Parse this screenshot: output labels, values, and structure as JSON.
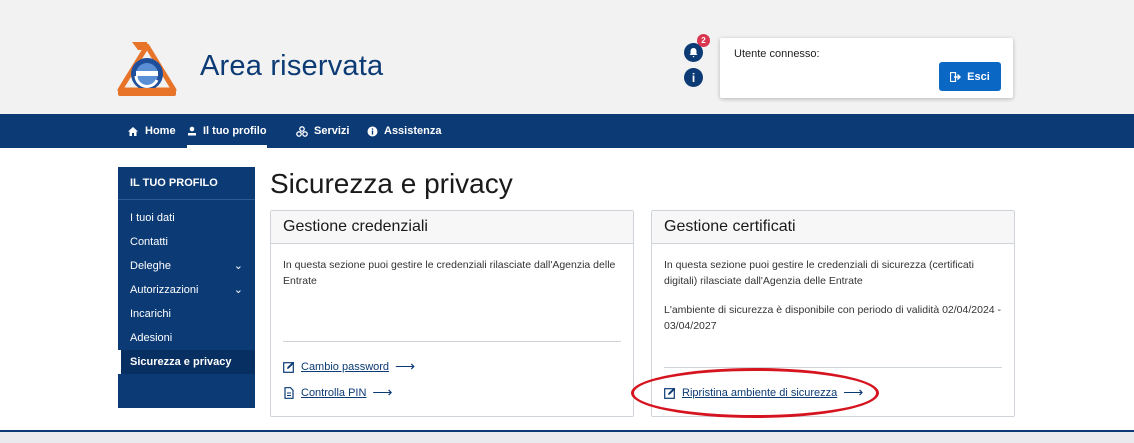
{
  "header": {
    "title": "Area riservata",
    "notification_count": "2",
    "user_label": "Utente connesso:",
    "logout_label": "Esci"
  },
  "nav": {
    "items": [
      {
        "label": "Home",
        "icon": "home-icon"
      },
      {
        "label": "Il tuo profilo",
        "icon": "user-icon"
      },
      {
        "label": "Servizi",
        "icon": "services-icon"
      },
      {
        "label": "Assistenza",
        "icon": "info-icon"
      }
    ],
    "active": "Il tuo profilo"
  },
  "sidebar": {
    "heading": "IL TUO PROFILO",
    "items": [
      {
        "label": "I tuoi dati"
      },
      {
        "label": "Contatti"
      },
      {
        "label": "Deleghe",
        "expandable": true
      },
      {
        "label": "Autorizzazioni",
        "expandable": true
      },
      {
        "label": "Incarichi"
      },
      {
        "label": "Adesioni"
      },
      {
        "label": "Sicurezza e privacy",
        "active": true
      }
    ]
  },
  "main": {
    "title": "Sicurezza e privacy",
    "cards": [
      {
        "title": "Gestione credenziali",
        "text": "In questa sezione puoi gestire le credenziali rilasciate dall'Agenzia delle Entrate",
        "links": [
          {
            "label": "Cambio password",
            "icon": "edit-icon"
          },
          {
            "label": "Controlla PIN",
            "icon": "document-icon"
          }
        ]
      },
      {
        "title": "Gestione certificati",
        "text": "In questa sezione puoi gestire le credenziali di sicurezza (certificati digitali) rilasciate dall'Agenzia delle Entrate",
        "text2": "L'ambiente di sicurezza è disponibile con periodo di validità 02/04/2024 - 03/04/2027",
        "links": [
          {
            "label": "Ripristina ambiente di sicurezza",
            "icon": "edit-icon"
          }
        ]
      }
    ]
  },
  "colors": {
    "primary": "#0b3a75",
    "button": "#0b67c4",
    "highlight": "#d6141f"
  }
}
